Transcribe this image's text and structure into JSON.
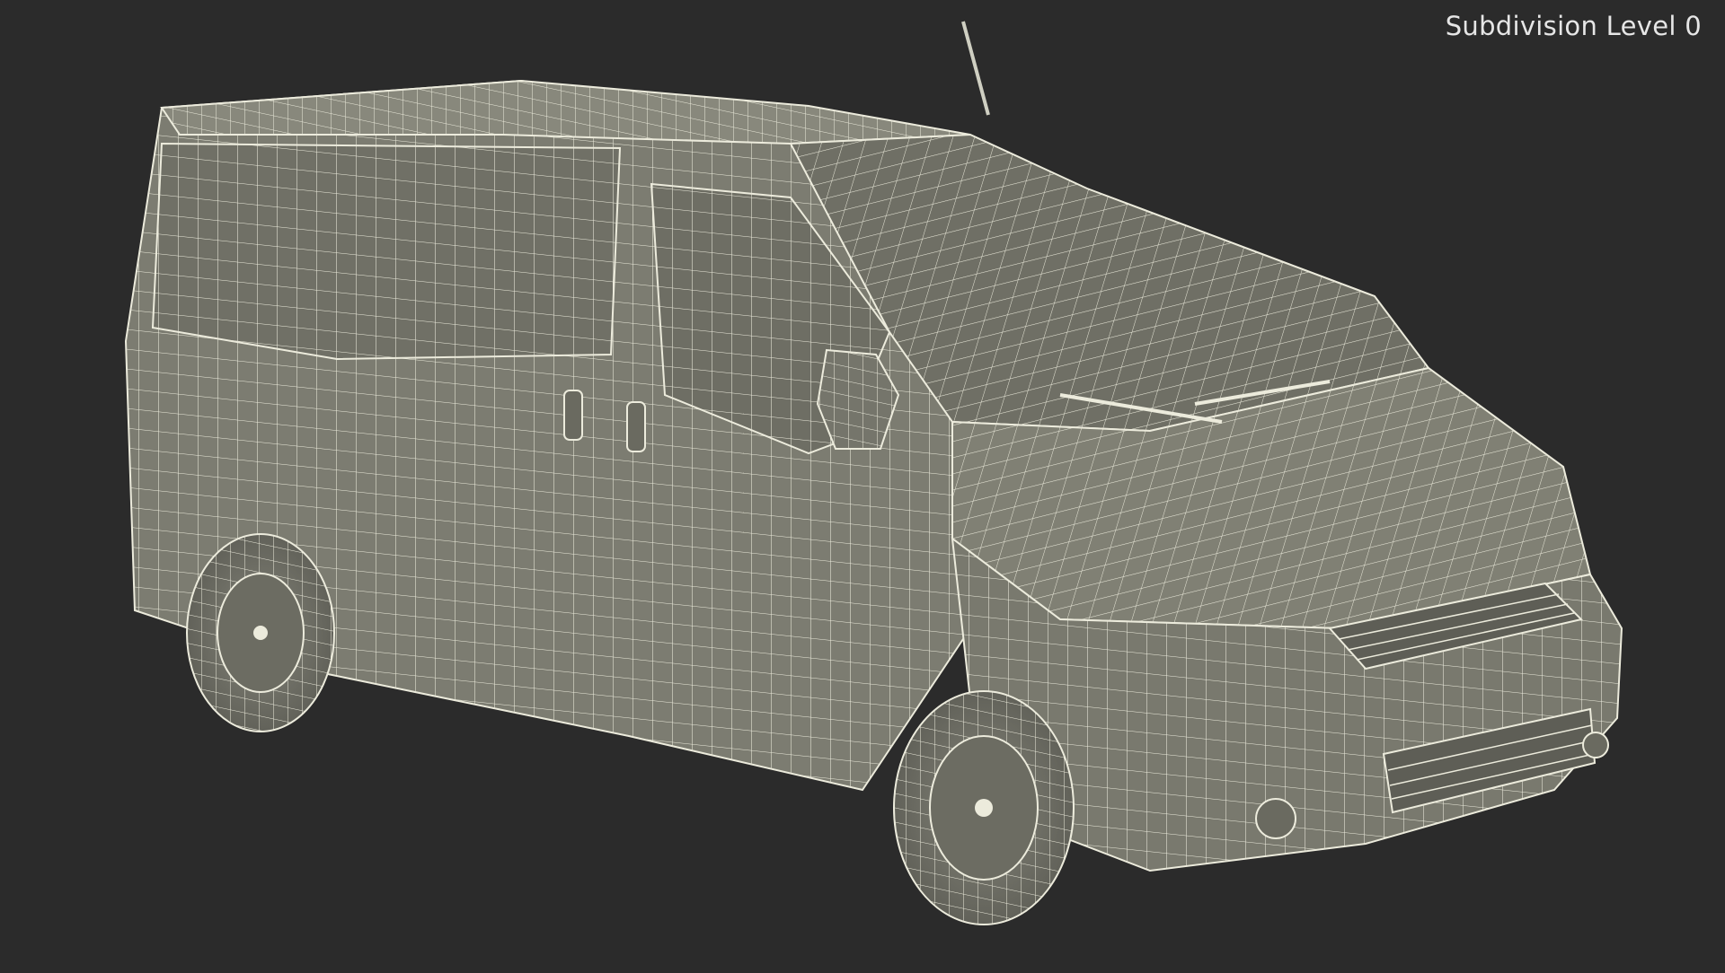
{
  "overlay": {
    "label": "Subdivision Level 0"
  },
  "colors": {
    "background": "#2b2b2b",
    "body_fill": "#7d7d72",
    "body_shade": "#6a6a60",
    "wire": "#ecebdc"
  },
  "scene": {
    "object": "van-wireframe-render"
  }
}
